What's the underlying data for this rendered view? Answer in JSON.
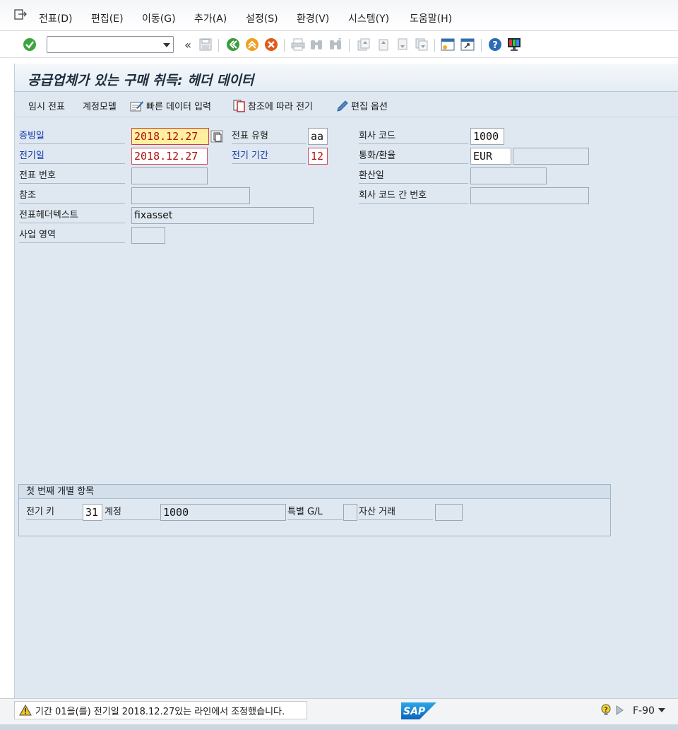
{
  "menubar": {
    "items": [
      {
        "label": "전표(D)"
      },
      {
        "label": "편집(E)"
      },
      {
        "label": "이동(G)"
      },
      {
        "label": "추가(A)"
      },
      {
        "label": "설정(S)"
      },
      {
        "label": "환경(V)"
      },
      {
        "label": "시스템(Y)"
      },
      {
        "label": "도움말(H)"
      }
    ]
  },
  "toolbar": {
    "command_field_value": "",
    "icons": [
      "enter-icon",
      "back-history-icon",
      "save-icon",
      "back-icon",
      "exit-icon",
      "cancel-icon",
      "print-icon",
      "find-icon",
      "find-next-icon",
      "first-page-icon",
      "previous-page-icon",
      "next-page-icon",
      "last-page-icon",
      "create-session-icon",
      "shortcut-icon",
      "help-icon",
      "customize-layout-icon"
    ]
  },
  "screen": {
    "title": "공급업체가 있는 구매 취득: 헤더 데이터",
    "app_toolbar": {
      "park": "임시 전표",
      "account_model": "계정모델",
      "fast_entry": "빠른 데이터 입력",
      "post_with_reference": "참조에 따라 전기",
      "editing_options": "편집 옵션"
    }
  },
  "header": {
    "document_date": {
      "label": "증빙일",
      "value": "2018.12.27"
    },
    "posting_date": {
      "label": "전기일",
      "value": "2018.12.27"
    },
    "document_number": {
      "label": "전표 번호",
      "value": ""
    },
    "reference": {
      "label": "참조",
      "value": ""
    },
    "header_text": {
      "label": "전표헤더텍스트",
      "value": "fixasset"
    },
    "business_area": {
      "label": "사업 영역",
      "value": ""
    },
    "document_type": {
      "label": "전표 유형",
      "value": "aa"
    },
    "period": {
      "label": "전기 기간",
      "value": "12"
    },
    "company_code": {
      "label": "회사 코드",
      "value": "1000"
    },
    "currency": {
      "label": "통화/환율",
      "value": "EUR",
      "rate": ""
    },
    "translation_date": {
      "label": "환산일",
      "value": ""
    },
    "cross_cc_number": {
      "label": "회사 코드 간 번호",
      "value": ""
    }
  },
  "first_item": {
    "title": "첫 번째 개별 항목",
    "posting_key": {
      "label": "전기 키",
      "value": "31"
    },
    "account": {
      "label": "계정",
      "value": "1000"
    },
    "special_gl": {
      "label": "특별 G/L",
      "value": ""
    },
    "asset_transaction": {
      "label": "자산 거래",
      "value": ""
    }
  },
  "statusbar": {
    "message": "기간 01을(를) 전기일 2018.12.27있는 라인에서 조정했습니다.",
    "logo": "SAP",
    "transaction": "F-90"
  },
  "colors": {
    "background": "#dfe8f1",
    "required_label": "#1034a6",
    "error_text": "#b01010",
    "active_field": "#ffef9f"
  }
}
